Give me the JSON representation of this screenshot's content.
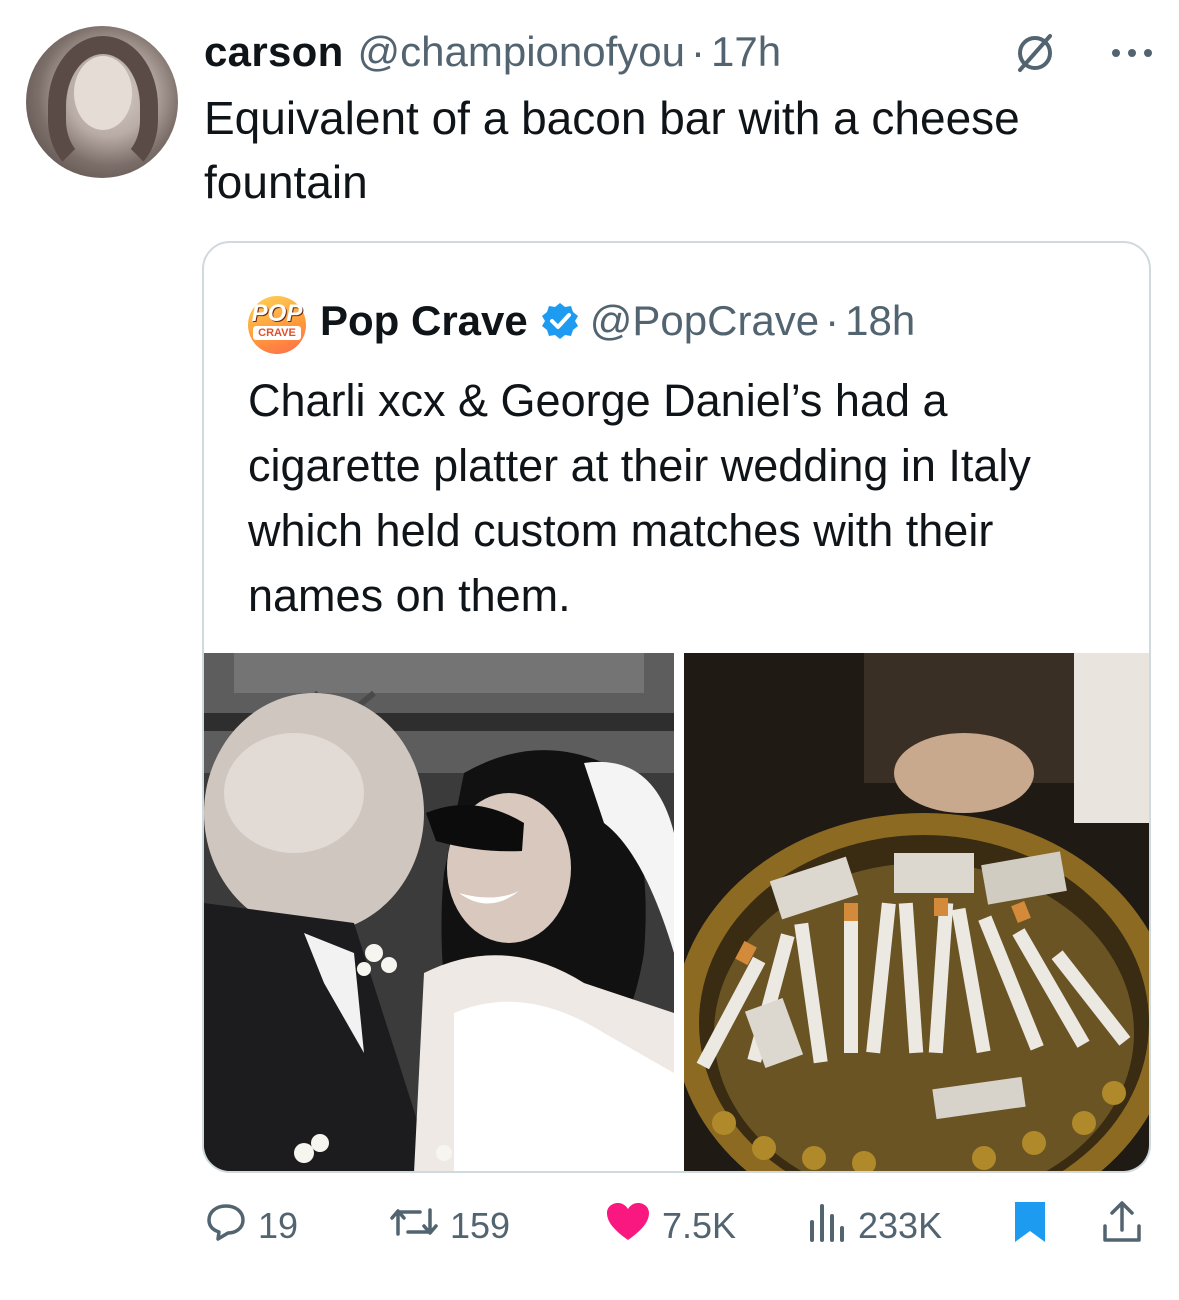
{
  "tweet": {
    "author_name": "carson",
    "author_handle": "@championofyou",
    "separator": "·",
    "time": "17h",
    "text": "Equivalent of a bacon bar with a cheese fountain"
  },
  "quoted_tweet": {
    "author_name": "Pop Crave",
    "author_handle": "@PopCrave",
    "separator": "·",
    "time": "18h",
    "verified": true,
    "logo_text_top": "POP",
    "logo_text_bottom": "CRAVE",
    "text": "Charli xcx & George Daniel’s had a cigarette platter at their wedding in Italy which held custom matches with their names on them.",
    "images": [
      {
        "icon": "wedding-kiss-photo"
      },
      {
        "icon": "cigarette-platter-photo"
      }
    ]
  },
  "actions": {
    "replies": "19",
    "reposts": "159",
    "likes": "7.5K",
    "views": "233K"
  },
  "colors": {
    "muted": "#536471",
    "like": "#f91880",
    "bookmark": "#1d9bf0",
    "verified": "#1d9bf0",
    "border": "#cfd9de"
  }
}
